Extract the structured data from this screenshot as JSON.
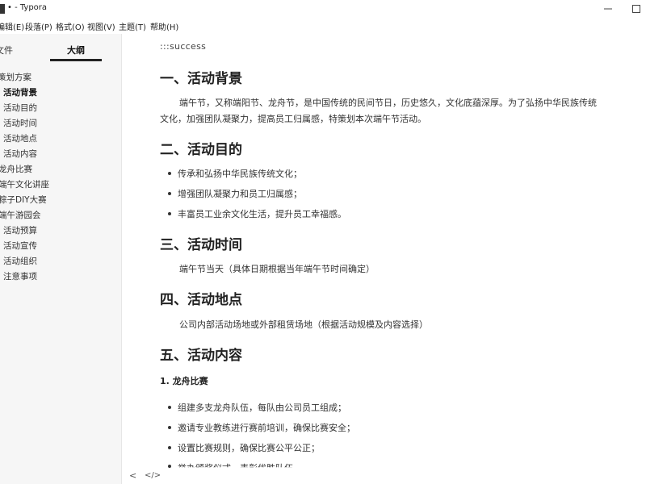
{
  "window": {
    "title": "• - Typora"
  },
  "menu": {
    "items": [
      {
        "label": "编辑(E)"
      },
      {
        "label": "段落(P)"
      },
      {
        "label": "格式(O)"
      },
      {
        "label": "视图(V)"
      },
      {
        "label": "主题(T)"
      },
      {
        "label": "帮助(H)"
      }
    ]
  },
  "sidebar": {
    "tab_files": "文件",
    "tab_outline": "大纲",
    "outline": [
      {
        "label": "策划方案"
      },
      {
        "label": "活动背景"
      },
      {
        "label": "活动目的"
      },
      {
        "label": "活动时间"
      },
      {
        "label": "活动地点"
      },
      {
        "label": "活动内容"
      },
      {
        "label": "龙舟比赛"
      },
      {
        "label": "端午文化讲座"
      },
      {
        "label": "粽子DIY大赛"
      },
      {
        "label": "端午游园会"
      },
      {
        "label": "活动预算"
      },
      {
        "label": "活动宣传"
      },
      {
        "label": "活动组织"
      },
      {
        "label": "注意事项"
      }
    ]
  },
  "doc": {
    "marker": ":::success",
    "h_background": "一、活动背景",
    "p_background_1": "端午节，又称端阳节、龙舟节，是中国传统的民间节日，历史悠久，文化底蕴深厚。为了弘扬中华民族传统",
    "p_background_2": "文化，加强团队凝聚力，提高员工归属感，特策划本次端午节活动。",
    "h_purpose": "二、活动目的",
    "purpose_items": [
      "传承和弘扬中华民族传统文化；",
      "增强团队凝聚力和员工归属感；",
      "丰富员工业余文化生活，提升员工幸福感。"
    ],
    "h_time": "三、活动时间",
    "p_time": "端午节当天（具体日期根据当年端午节时间确定）",
    "h_place": "四、活动地点",
    "p_place": "公司内部活动场地或外部租赁场地（根据活动规模及内容选择）",
    "h_content": "五、活动内容",
    "h3_dragon": "1. 龙舟比赛",
    "dragon_items": [
      "组建多支龙舟队伍，每队由公司员工组成；",
      "邀请专业教练进行赛前培训，确保比赛安全；",
      "设置比赛规则，确保比赛公平公正；",
      "举办颁奖仪式，表彰优胜队伍"
    ]
  },
  "status": {
    "back_icon": "<",
    "source_icon": "</>"
  },
  "icons": {
    "app": "typora-app-icon",
    "minimize": "minimize-icon",
    "maximize": "maximize-icon"
  }
}
